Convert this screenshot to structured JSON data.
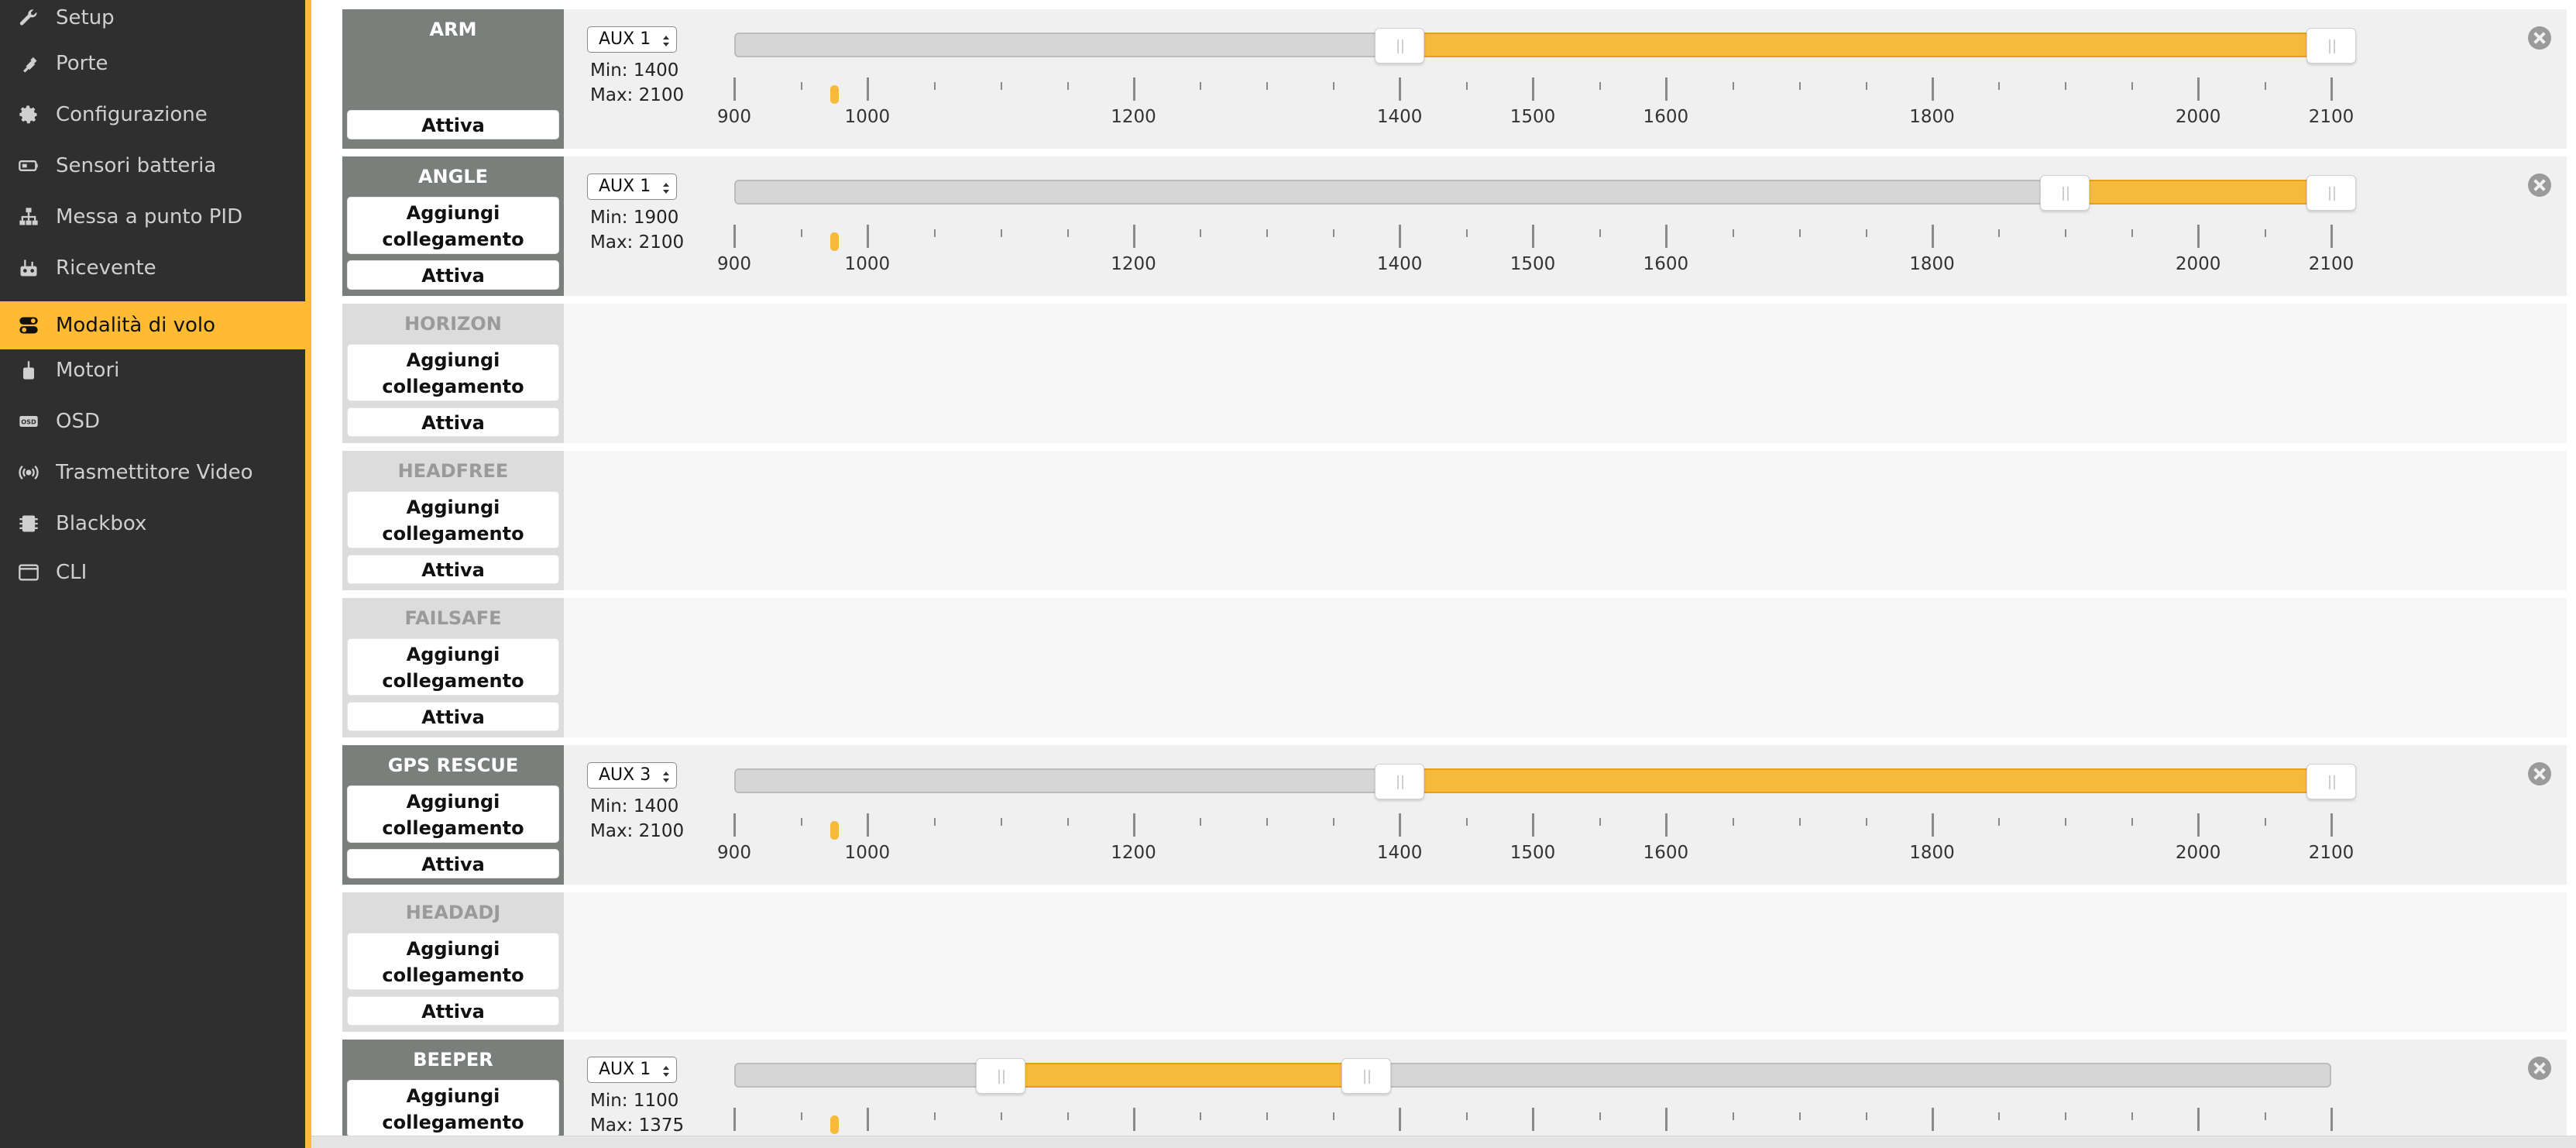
{
  "sidebar": {
    "items": [
      {
        "label": "Setup",
        "icon": "wrench-icon"
      },
      {
        "label": "Porte",
        "icon": "plug-icon"
      },
      {
        "label": "Configurazione",
        "icon": "gear-icon"
      },
      {
        "label": "Sensori batteria",
        "icon": "battery-icon"
      },
      {
        "label": "Messa a punto PID",
        "icon": "pid-tree-icon"
      },
      {
        "label": "Ricevente",
        "icon": "receiver-icon"
      },
      {
        "label": "Modalità di volo",
        "icon": "toggle-icon",
        "active": true
      },
      {
        "label": "Motori",
        "icon": "motor-icon"
      },
      {
        "label": "OSD",
        "icon": "osd-icon"
      },
      {
        "label": "Trasmettitore Video",
        "icon": "broadcast-icon"
      },
      {
        "label": "Blackbox",
        "icon": "blackbox-icon"
      },
      {
        "label": "CLI",
        "icon": "terminal-icon"
      }
    ]
  },
  "buttons": {
    "add_link": "Aggiungi collegamento",
    "activate": "Attiva"
  },
  "labels": {
    "min_prefix": "Min: ",
    "max_prefix": "Max: "
  },
  "scale": {
    "min": 900,
    "max": 2100,
    "major_ticks": [
      900,
      1000,
      1200,
      1400,
      1500,
      1600,
      1800,
      2000,
      2100
    ],
    "rc_value": 975
  },
  "modes": [
    {
      "name": "ARM",
      "has_range": true,
      "show_link_button": false,
      "channel": "AUX 1",
      "min": 1400,
      "max": 2100
    },
    {
      "name": "ANGLE",
      "has_range": true,
      "show_link_button": true,
      "channel": "AUX 1",
      "min": 1900,
      "max": 2100
    },
    {
      "name": "HORIZON",
      "has_range": false,
      "show_link_button": true
    },
    {
      "name": "HEADFREE",
      "has_range": false,
      "show_link_button": true
    },
    {
      "name": "FAILSAFE",
      "has_range": false,
      "show_link_button": true
    },
    {
      "name": "GPS RESCUE",
      "has_range": true,
      "show_link_button": true,
      "channel": "AUX 3",
      "min": 1400,
      "max": 2100
    },
    {
      "name": "HEADADJ",
      "has_range": false,
      "show_link_button": true
    },
    {
      "name": "BEEPER",
      "has_range": true,
      "show_link_button": true,
      "channel": "AUX 1",
      "min": 1100,
      "max": 1375,
      "partial": true
    }
  ],
  "colors": {
    "accent": "#ffbb33",
    "sidebar_bg": "#2f2f2f",
    "range_fill": "#f7b93a",
    "active_mode_header": "#7a7f7b"
  }
}
